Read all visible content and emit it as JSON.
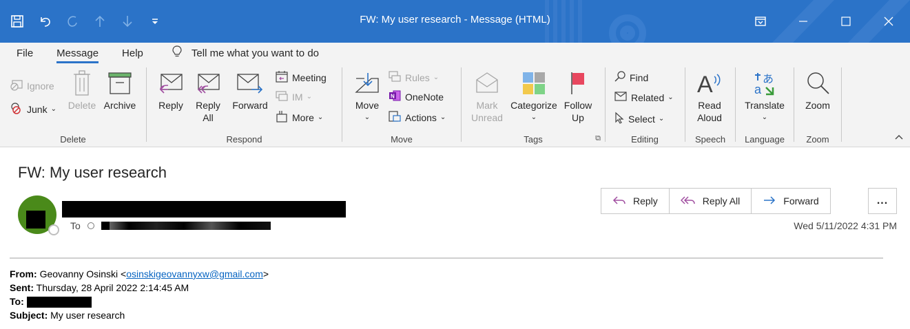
{
  "window": {
    "title": "FW: My user research - Message (HTML)",
    "title_bar_color": "#2b73c8"
  },
  "qat": {
    "icons": [
      "save-icon",
      "undo-icon",
      "redo-icon",
      "up-arrow-icon",
      "down-arrow-icon",
      "customize-qat-icon"
    ]
  },
  "menu": {
    "tabs": [
      "File",
      "Message",
      "Help"
    ],
    "active_tab": "Message",
    "tell_me": "Tell me what you want to do"
  },
  "ribbon": {
    "delete": {
      "label": "Delete",
      "ignore": "Ignore",
      "junk": "Junk",
      "delete": "Delete",
      "archive": "Archive"
    },
    "respond": {
      "label": "Respond",
      "reply": "Reply",
      "reply_all_1": "Reply",
      "reply_all_2": "All",
      "forward": "Forward",
      "meeting": "Meeting",
      "im": "IM",
      "more": "More"
    },
    "move": {
      "label": "Move",
      "move": "Move",
      "rules": "Rules",
      "onenote": "OneNote",
      "actions": "Actions"
    },
    "tags": {
      "label": "Tags",
      "mark_unread_1": "Mark",
      "mark_unread_2": "Unread",
      "categorize": "Categorize",
      "follow_up_1": "Follow",
      "follow_up_2": "Up"
    },
    "editing": {
      "label": "Editing",
      "find": "Find",
      "related": "Related",
      "select": "Select"
    },
    "speech": {
      "label": "Speech",
      "read_aloud_1": "Read",
      "read_aloud_2": "Aloud"
    },
    "language": {
      "label": "Language",
      "translate": "Translate"
    },
    "zoom": {
      "label": "Zoom",
      "zoom": "Zoom"
    }
  },
  "message": {
    "subject": "FW: My user research",
    "to_label": "To",
    "date": "Wed 5/11/2022 4:31 PM",
    "actions": {
      "reply": "Reply",
      "reply_all": "Reply All",
      "forward": "Forward",
      "more": "..."
    },
    "forwarded": {
      "from_label": "From:",
      "from_name": "Geovanny Osinski <",
      "from_email": "osinskigeovannyxw@gmail.com",
      "from_end": ">",
      "sent_label": "Sent:",
      "sent_value": "Thursday, 28 April 2022 2:14:45 AM",
      "to_label": "To:",
      "subject_label": "Subject:",
      "subject_value": "My user research"
    }
  }
}
